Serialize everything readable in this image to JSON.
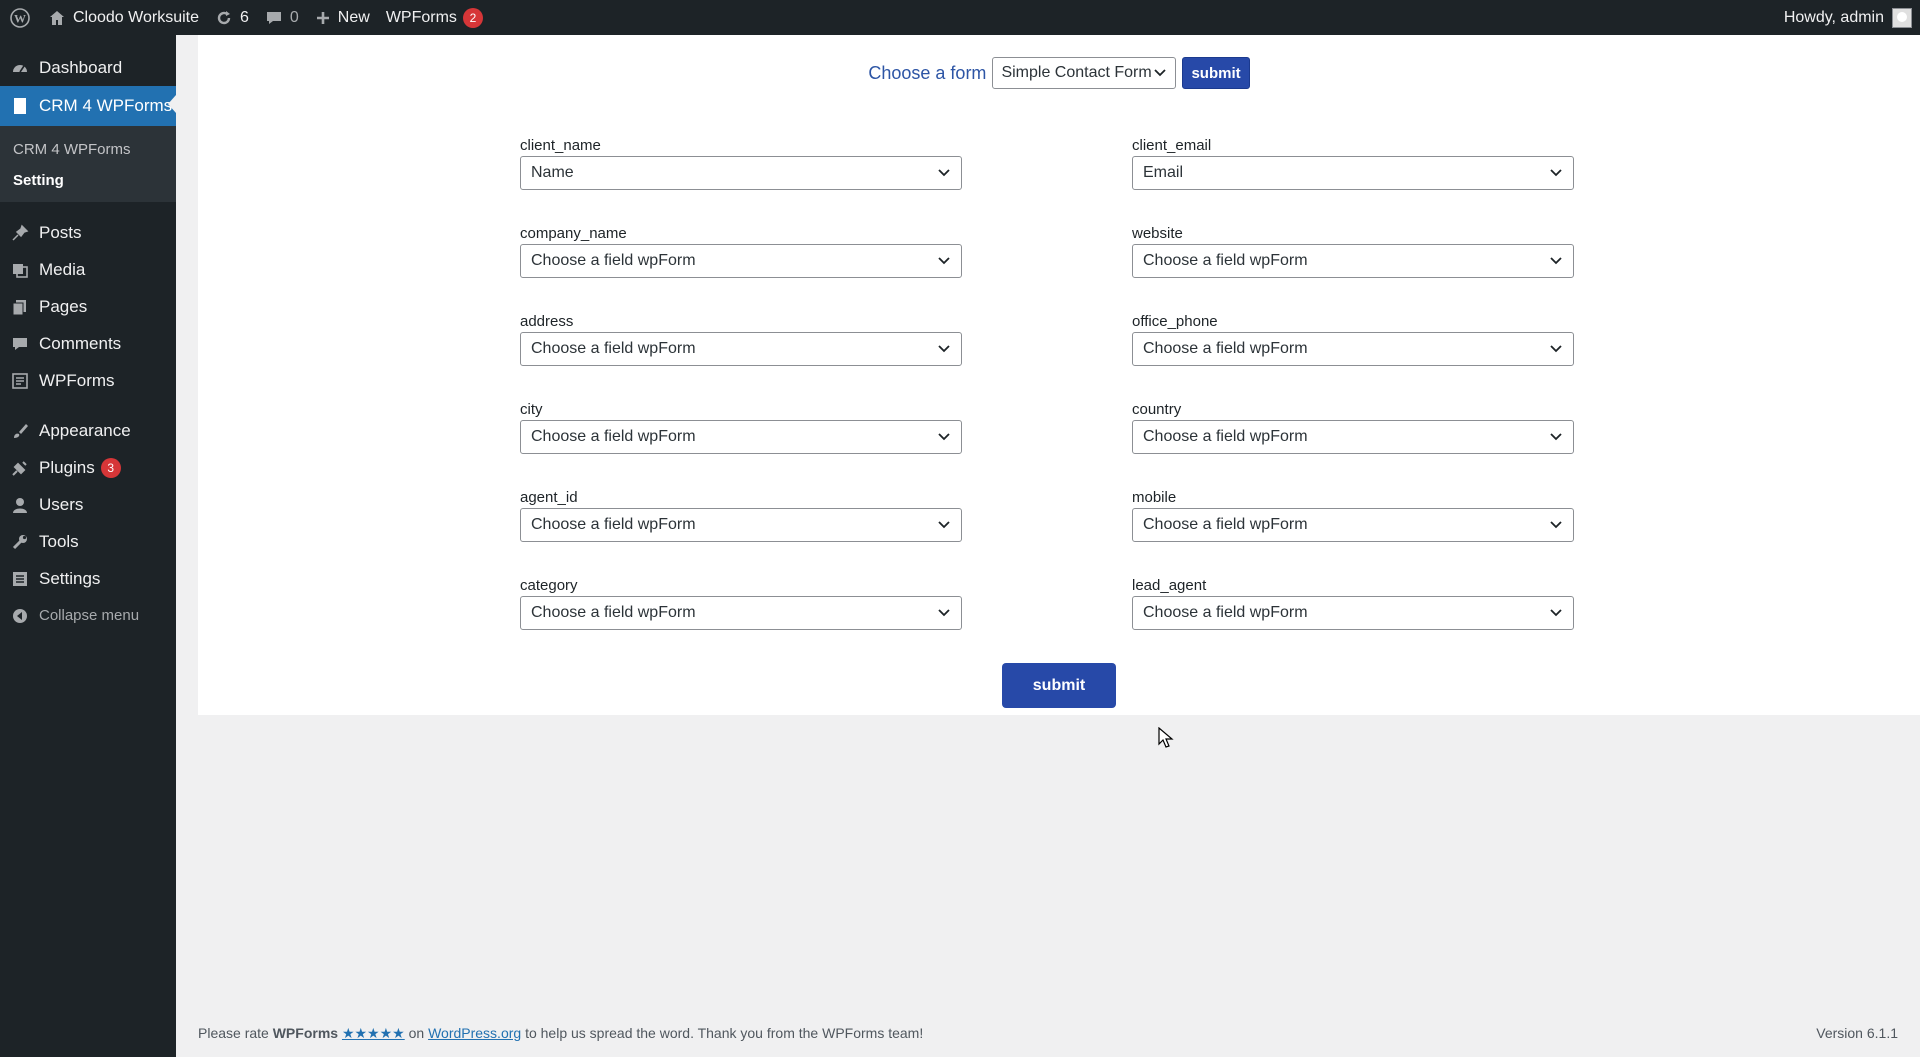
{
  "adminbar": {
    "site_name": "Cloodo Worksuite",
    "updates_count": "6",
    "comments_count": "0",
    "new_label": "New",
    "wpforms_label": "WPForms",
    "wpforms_badge": "2",
    "greeting": "Howdy, admin"
  },
  "sidebar": {
    "items": [
      {
        "label": "Dashboard",
        "icon": "dashboard-icon"
      },
      {
        "label": "CRM 4 WPForms",
        "icon": "document-icon"
      },
      {
        "label": "Posts",
        "icon": "pin-icon"
      },
      {
        "label": "Media",
        "icon": "media-icon"
      },
      {
        "label": "Pages",
        "icon": "pages-icon"
      },
      {
        "label": "Comments",
        "icon": "comment-icon"
      },
      {
        "label": "WPForms",
        "icon": "form-icon"
      },
      {
        "label": "Appearance",
        "icon": "brush-icon"
      },
      {
        "label": "Plugins",
        "icon": "plugin-icon",
        "badge": "3"
      },
      {
        "label": "Users",
        "icon": "user-icon"
      },
      {
        "label": "Tools",
        "icon": "wrench-icon"
      },
      {
        "label": "Settings",
        "icon": "settings-icon"
      }
    ],
    "submenu": [
      "CRM 4 WPForms",
      "Setting"
    ],
    "collapse_label": "Collapse menu"
  },
  "form": {
    "choose_label": "Choose a form",
    "selected_form": "Simple Contact Form",
    "top_submit": "submit",
    "fields": [
      {
        "label": "client_name",
        "value": "Name"
      },
      {
        "label": "client_email",
        "value": "Email"
      },
      {
        "label": "company_name",
        "value": "Choose a field wpForm"
      },
      {
        "label": "website",
        "value": "Choose a field wpForm"
      },
      {
        "label": "address",
        "value": "Choose a field wpForm"
      },
      {
        "label": "office_phone",
        "value": "Choose a field wpForm"
      },
      {
        "label": "city",
        "value": "Choose a field wpForm"
      },
      {
        "label": "country",
        "value": "Choose a field wpForm"
      },
      {
        "label": "agent_id",
        "value": "Choose a field wpForm"
      },
      {
        "label": "mobile",
        "value": "Choose a field wpForm"
      },
      {
        "label": "category",
        "value": "Choose a field wpForm"
      },
      {
        "label": "lead_agent",
        "value": "Choose a field wpForm"
      }
    ],
    "submit_label": "submit"
  },
  "footer": {
    "text_1": "Please rate ",
    "brand": "WPForms",
    "stars": "★★★★★",
    "text_2": " on ",
    "link": "WordPress.org",
    "text_3": " to help us spread the word. Thank you from the WPForms team!",
    "version": "Version 6.1.1"
  },
  "colors": {
    "adminbar_bg": "#1d2327",
    "menu_current": "#2271b1",
    "button_blue": "#2749a8",
    "badge_red": "#d63638"
  }
}
